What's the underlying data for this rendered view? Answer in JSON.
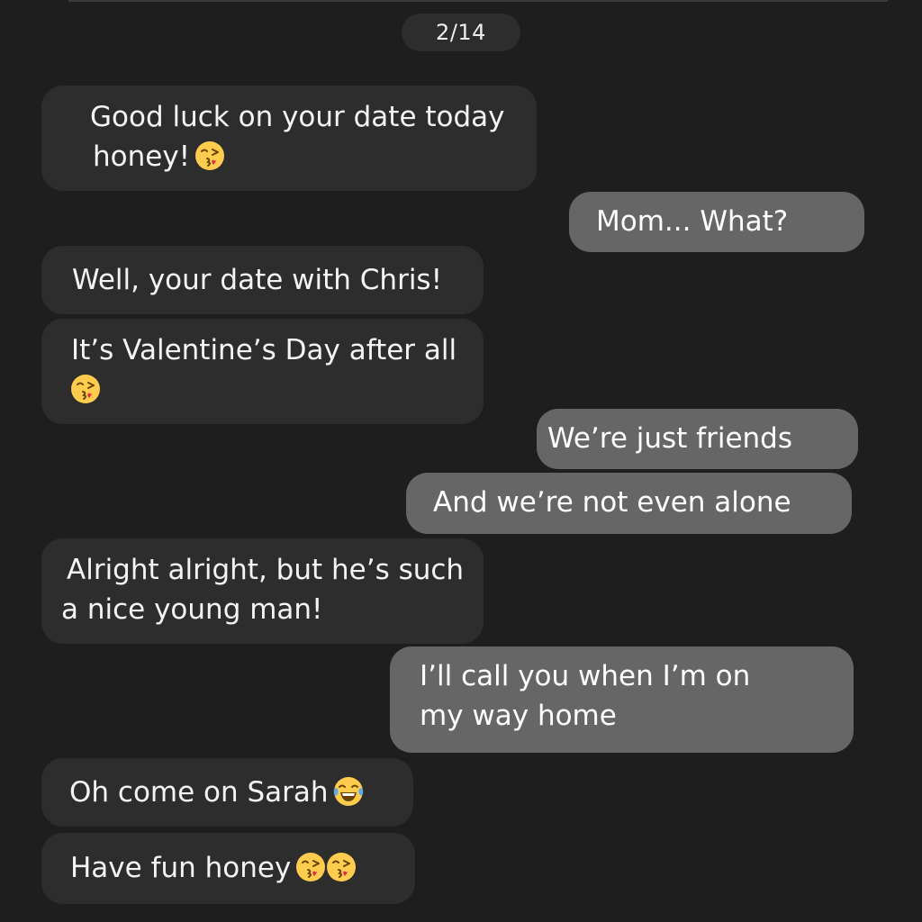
{
  "header": {
    "date_label": "2/14"
  },
  "messages": [
    {
      "direction": "incoming",
      "lines": [
        "Good luck on your date today",
        "honey!"
      ],
      "emoji": [
        "kissing-heart"
      ]
    },
    {
      "direction": "outgoing",
      "lines": [
        "Mom... What?"
      ],
      "emoji": []
    },
    {
      "direction": "incoming",
      "lines": [
        "Well, your date with Chris!"
      ],
      "emoji": []
    },
    {
      "direction": "incoming",
      "lines": [
        "It’s Valentine’s Day after all",
        ""
      ],
      "emoji": [
        "kissing-heart"
      ]
    },
    {
      "direction": "outgoing",
      "lines": [
        "We’re just friends"
      ],
      "emoji": []
    },
    {
      "direction": "outgoing",
      "lines": [
        "And we’re not even alone"
      ],
      "emoji": []
    },
    {
      "direction": "incoming",
      "lines": [
        "Alright alright, but he’s such",
        "a nice young man!"
      ],
      "emoji": []
    },
    {
      "direction": "outgoing",
      "lines": [
        "I’ll call you when I’m on",
        "my way home"
      ],
      "emoji": []
    },
    {
      "direction": "incoming",
      "lines": [
        "Oh come on Sarah"
      ],
      "emoji": [
        "tears-of-joy"
      ]
    },
    {
      "direction": "incoming",
      "lines": [
        "Have fun honey"
      ],
      "emoji": [
        "kissing-heart",
        "kissing-heart"
      ]
    }
  ],
  "colors": {
    "background": "#1e1e1e",
    "incoming_bubble": "#2d2d2d",
    "outgoing_bubble": "#666666",
    "emoji_yellow": "#ffcc4d"
  }
}
